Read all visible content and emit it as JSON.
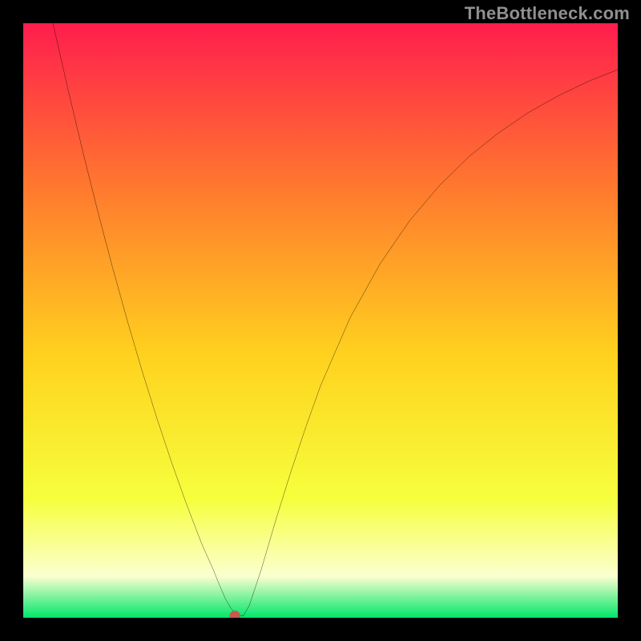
{
  "watermark": "TheBottleneck.com",
  "chart_data": {
    "type": "line",
    "title": "",
    "xlabel": "",
    "ylabel": "",
    "xlim": [
      0,
      100
    ],
    "ylim": [
      0,
      100
    ],
    "grid": false,
    "legend": null,
    "background_gradient": {
      "top": "#ff1d4d",
      "upper_mid": "#ff7a2e",
      "mid": "#ffd21e",
      "lower_mid": "#f6ff3d",
      "pale": "#fbffd0",
      "bottom": "#00e66a"
    },
    "marker": {
      "x": 35.6,
      "y": 0.3,
      "color": "#c65a4f",
      "radius_pct": 0.9
    },
    "series": [
      {
        "name": "curve",
        "color": "#000000",
        "x": [
          5,
          7.5,
          10,
          12.5,
          15,
          17.5,
          20,
          22.5,
          25,
          27.5,
          30,
          32,
          33,
          34,
          35,
          36,
          37,
          38,
          40,
          42.5,
          45,
          47.5,
          50,
          55,
          60,
          65,
          70,
          75,
          80,
          85,
          90,
          95,
          100
        ],
        "y": [
          100,
          89,
          78.5,
          68.5,
          59,
          50,
          41.5,
          33.5,
          26,
          19,
          12.5,
          8,
          5.5,
          3.2,
          1.5,
          0.5,
          0.3,
          2,
          8,
          16.5,
          24.5,
          32,
          39,
          50.5,
          59.5,
          66.8,
          72.7,
          77.6,
          81.6,
          85,
          87.8,
          90.2,
          92.2
        ]
      }
    ]
  }
}
